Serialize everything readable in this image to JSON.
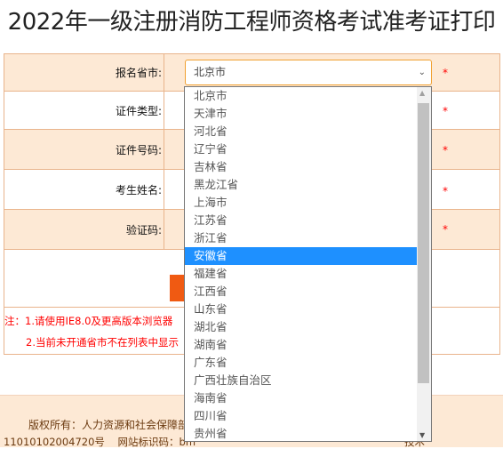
{
  "title": "2022年一级注册消防工程师资格考试准考证打印",
  "form": {
    "province_label": "报名省市:",
    "province_value": "北京市",
    "id_type_label": "证件类型:",
    "id_number_label": "证件号码:",
    "name_label": "考生姓名:",
    "captcha_label": "验证码:",
    "required_mark": "*"
  },
  "notes": {
    "n1": "注：1.请使用IE8.0及更高版本浏览器",
    "n2": "2.当前未开通省市不在列表中显示"
  },
  "footer": {
    "copyright": "版权所有：人力资源和社会保障部",
    "icp": "11010102004720号    网站标识码：bm",
    "tech": "技术"
  },
  "dropdown": {
    "selected_index": 9,
    "options": [
      "北京市",
      "天津市",
      "河北省",
      "辽宁省",
      "吉林省",
      "黑龙江省",
      "上海市",
      "江苏省",
      "浙江省",
      "安徽省",
      "福建省",
      "江西省",
      "山东省",
      "湖北省",
      "湖南省",
      "广东省",
      "广西壮族自治区",
      "海南省",
      "四川省",
      "贵州省"
    ]
  },
  "colors": {
    "accent": "#f05a12",
    "row_bg": "#fde9d5",
    "border": "#e9b48c",
    "highlight": "#1e90ff"
  }
}
